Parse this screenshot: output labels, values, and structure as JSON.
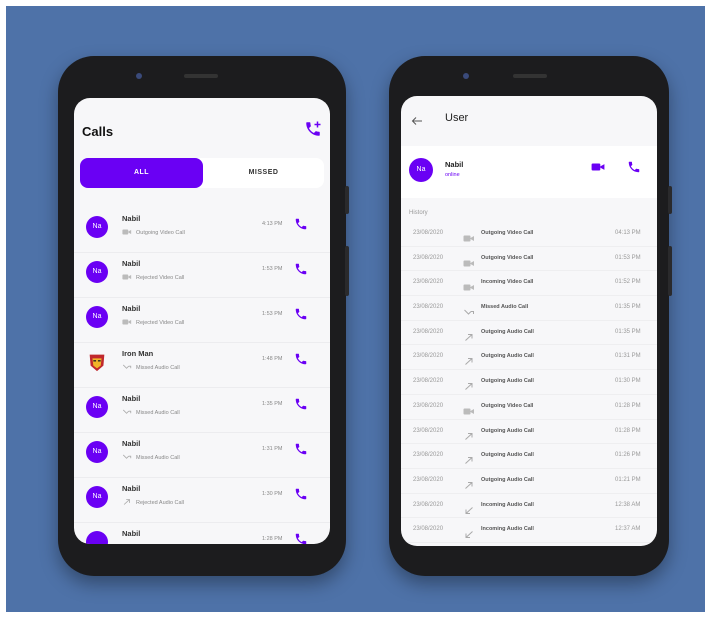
{
  "calls_screen": {
    "title": "Calls",
    "tabs": [
      {
        "label": "ALL",
        "active": true
      },
      {
        "label": "MISSED",
        "active": false
      }
    ],
    "accent_color": "#6a00f4",
    "items": [
      {
        "initials": "Na",
        "name": "Nabil",
        "type": "Outgoing Video Call",
        "icon": "video-icon",
        "time": "4:13 PM"
      },
      {
        "initials": "Na",
        "name": "Nabil",
        "type": "Rejected Video Call",
        "icon": "video-icon",
        "time": "1:53 PM"
      },
      {
        "initials": "Na",
        "name": "Nabil",
        "type": "Rejected Video Call",
        "icon": "video-icon",
        "time": "1:53 PM"
      },
      {
        "initials": "",
        "name": "Iron Man",
        "type": "Missed Audio Call",
        "icon": "missed-call-icon",
        "time": "1:48 PM",
        "avatar": "iron-man-mask"
      },
      {
        "initials": "Na",
        "name": "Nabil",
        "type": "Missed Audio Call",
        "icon": "missed-call-icon",
        "time": "1:35 PM"
      },
      {
        "initials": "Na",
        "name": "Nabil",
        "type": "Missed Audio Call",
        "icon": "missed-call-icon",
        "time": "1:31 PM"
      },
      {
        "initials": "Na",
        "name": "Nabil",
        "type": "Rejected Audio Call",
        "icon": "outgoing-arrow-icon",
        "time": "1:30 PM"
      },
      {
        "initials": "",
        "name": "Nabil",
        "type": "",
        "icon": "",
        "time": "1:28 PM"
      }
    ]
  },
  "user_screen": {
    "title": "User",
    "user": {
      "initials": "Na",
      "name": "Nabil",
      "status": "online"
    },
    "history_label": "History",
    "history": [
      {
        "date": "23/08/2020",
        "icon": "video-icon",
        "type": "Outgoing Video Call",
        "time": "04:13 PM"
      },
      {
        "date": "23/08/2020",
        "icon": "video-icon",
        "type": "Outgoing Video Call",
        "time": "01:53 PM"
      },
      {
        "date": "23/08/2020",
        "icon": "video-icon",
        "type": "Incoming Video Call",
        "time": "01:52 PM"
      },
      {
        "date": "23/08/2020",
        "icon": "missed-call-icon",
        "type": "Missed Audio Call",
        "time": "01:35 PM"
      },
      {
        "date": "23/08/2020",
        "icon": "outgoing-arrow-icon",
        "type": "Outgoing Audio Call",
        "time": "01:35 PM"
      },
      {
        "date": "23/08/2020",
        "icon": "outgoing-arrow-icon",
        "type": "Outgoing Audio Call",
        "time": "01:31 PM"
      },
      {
        "date": "23/08/2020",
        "icon": "outgoing-arrow-icon",
        "type": "Outgoing Audio Call",
        "time": "01:30 PM"
      },
      {
        "date": "23/08/2020",
        "icon": "video-icon",
        "type": "Outgoing Video Call",
        "time": "01:28 PM"
      },
      {
        "date": "23/08/2020",
        "icon": "outgoing-arrow-icon",
        "type": "Outgoing Audio Call",
        "time": "01:28 PM"
      },
      {
        "date": "23/08/2020",
        "icon": "outgoing-arrow-icon",
        "type": "Outgoing Audio Call",
        "time": "01:26 PM"
      },
      {
        "date": "23/08/2020",
        "icon": "outgoing-arrow-icon",
        "type": "Outgoing Audio Call",
        "time": "01:21 PM"
      },
      {
        "date": "23/08/2020",
        "icon": "incoming-arrow-icon",
        "type": "Incoming Audio Call",
        "time": "12:38 AM"
      },
      {
        "date": "23/08/2020",
        "icon": "incoming-arrow-icon",
        "type": "Incoming Audio Call",
        "time": "12:37 AM"
      }
    ]
  },
  "colors": {
    "background": "#4e72a8",
    "phone_body": "#1c1c1e",
    "accent": "#6a00f4"
  }
}
